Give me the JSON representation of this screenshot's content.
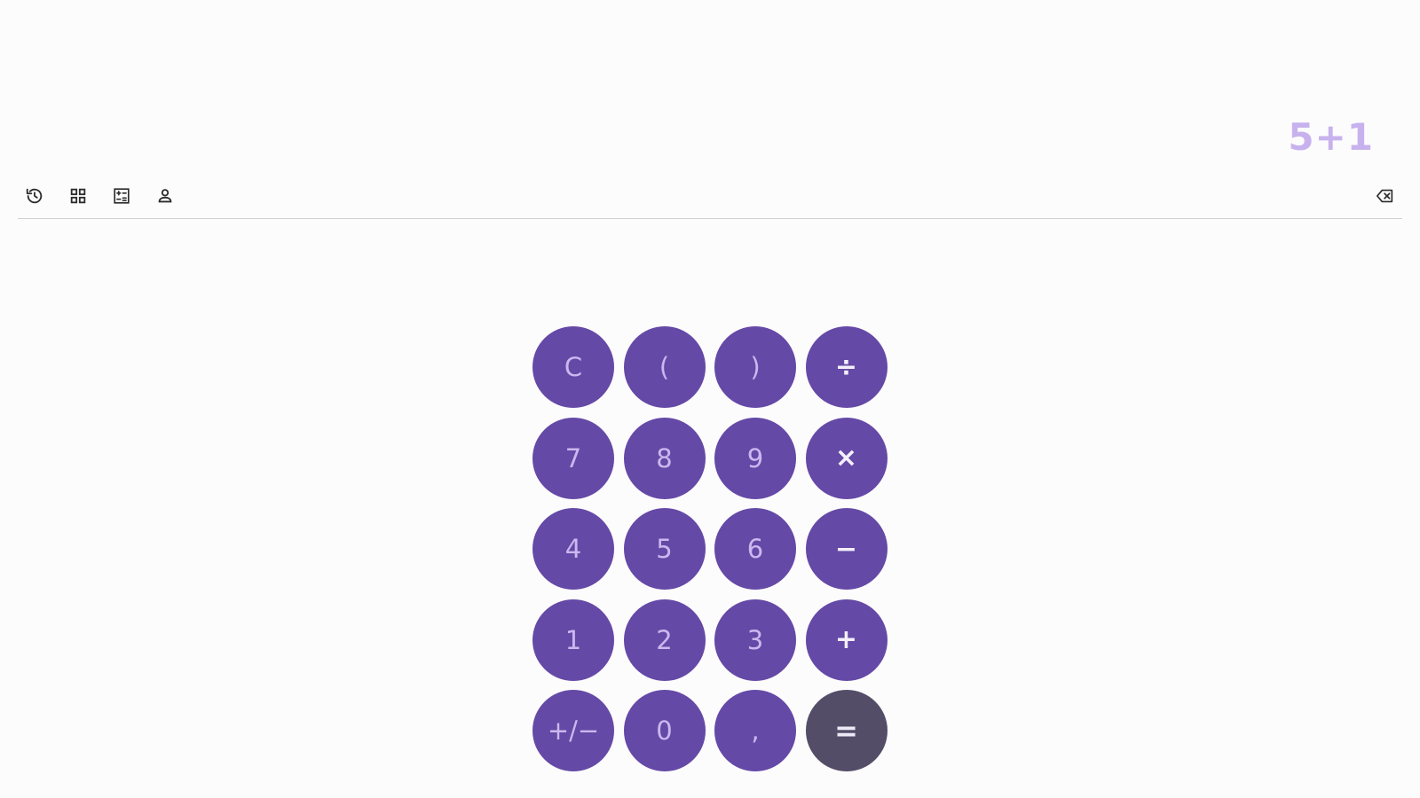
{
  "display": {
    "expression": "5+1"
  },
  "toolbar": {
    "icons": [
      "history-icon",
      "grid-icon",
      "calculator-icon",
      "person-icon",
      "backspace-icon"
    ]
  },
  "keypad": {
    "clear": "C",
    "open_paren": "(",
    "close_paren": ")",
    "divide": "÷",
    "seven": "7",
    "eight": "8",
    "nine": "9",
    "multiply": "×",
    "four": "4",
    "five": "5",
    "six": "6",
    "minus": "−",
    "one": "1",
    "two": "2",
    "three": "3",
    "plus": "+",
    "negate": "+/−",
    "zero": "0",
    "comma": ",",
    "equals": "="
  },
  "colors": {
    "key_bg": "#6549a6",
    "key_text": "#cbb8ef",
    "equals_bg": "#544d68",
    "display_text": "#c8b2ee",
    "page_bg": "#fdfcfd"
  }
}
